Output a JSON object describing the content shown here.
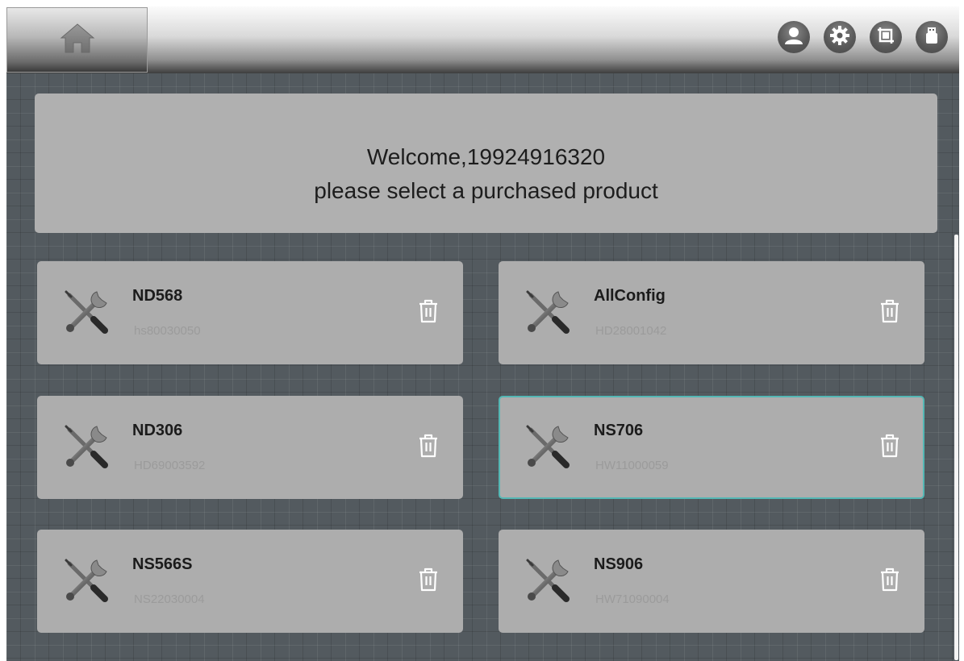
{
  "header": {
    "icons": [
      "home-icon",
      "user-icon",
      "settings-icon",
      "screen-capture-icon",
      "usb-drive-icon"
    ]
  },
  "welcome": {
    "line1": "Welcome,19924916320",
    "line2": "please select a purchased product"
  },
  "products": [
    {
      "name": "ND568",
      "serial": "hs80030050"
    },
    {
      "name": "AllConfig",
      "serial": "HD28001042"
    },
    {
      "name": "ND306",
      "serial": "HD69003592"
    },
    {
      "name": "NS706",
      "serial": "HW11000059",
      "selected": true
    },
    {
      "name": "NS566S",
      "serial": "NS22030004"
    },
    {
      "name": "NS906",
      "serial": "HW71090004"
    }
  ],
  "colors": {
    "background": "#535a5f",
    "card": "#adadad",
    "selected_border": "#54b7b4",
    "serial_text": "#9b9b9b"
  }
}
